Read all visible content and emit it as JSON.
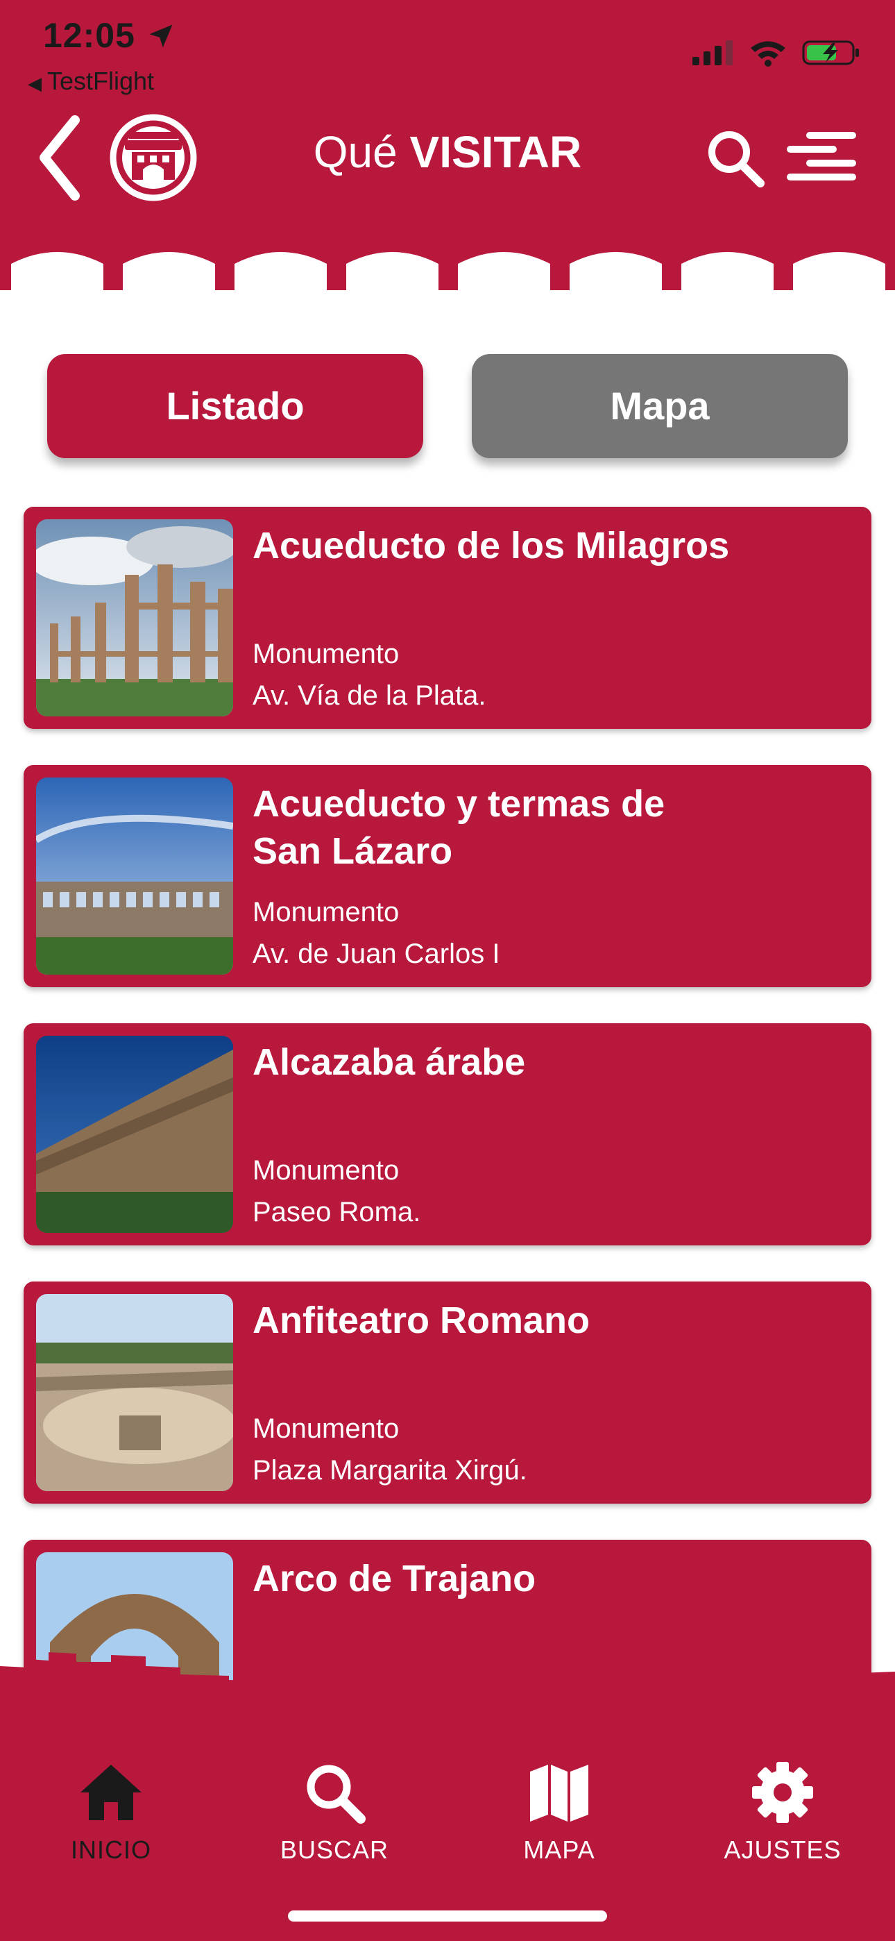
{
  "status_bar": {
    "time": "12:05",
    "back_app_label": "TestFlight"
  },
  "header": {
    "title_light": "Qué ",
    "title_bold": "VISITAR",
    "back_icon": "chevron-left-icon",
    "logo_icon": "city-emblem-icon",
    "search_icon": "search-icon",
    "menu_icon": "filter-menu-icon"
  },
  "view_toggle": {
    "listado_label": "Listado",
    "mapa_label": "Mapa"
  },
  "places": [
    {
      "title": "Acueducto de los Milagros",
      "type": "Monumento",
      "address": "Av. Vía de la Plata."
    },
    {
      "title": "Acueducto y termas de San Lázaro",
      "type": "Monumento",
      "address": "Av. de Juan Carlos I"
    },
    {
      "title": "Alcazaba árabe",
      "type": "Monumento",
      "address": "Paseo Roma."
    },
    {
      "title": "Anfiteatro Romano",
      "type": "Monumento",
      "address": "Plaza Margarita Xirgú."
    },
    {
      "title": "Arco de Trajano",
      "type": "",
      "address": ""
    }
  ],
  "bottom_nav": {
    "items": [
      {
        "label": "INICIO",
        "icon": "home-icon"
      },
      {
        "label": "BUSCAR",
        "icon": "search-icon"
      },
      {
        "label": "MAPA",
        "icon": "map-icon"
      },
      {
        "label": "AJUSTES",
        "icon": "gear-icon"
      }
    ]
  },
  "colors": {
    "brand": "#b8183c",
    "inactive_button": "#767676",
    "white": "#ffffff"
  }
}
